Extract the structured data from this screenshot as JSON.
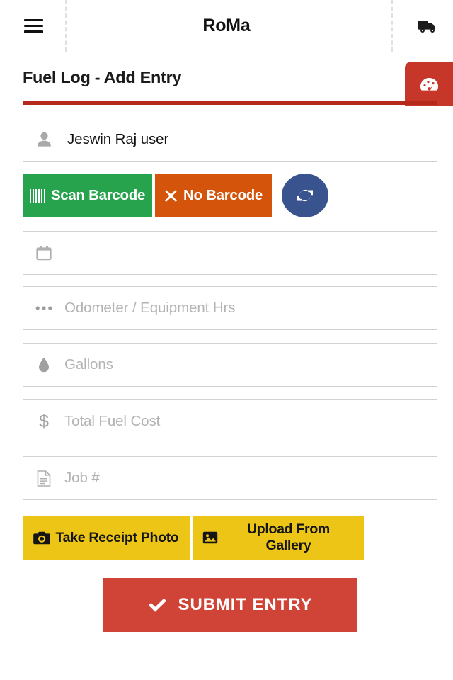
{
  "appbar": {
    "menu_icon": "hamburger-menu-icon",
    "title": "RoMa",
    "truck_icon": "truck-icon"
  },
  "page": {
    "title": "Fuel Log - Add Entry",
    "dashboard_tab_icon": "dashboard-gauge-icon",
    "accent_red": "#b5291c",
    "tab_red": "#c63729"
  },
  "form": {
    "user": {
      "icon": "user-icon",
      "value": "Jeswin Raj user"
    },
    "barcode": {
      "scan_label": "Scan Barcode",
      "scan_icon": "barcode-icon",
      "scan_color": "#27a34e",
      "no_barcode_label": "No Barcode",
      "no_barcode_icon": "close-x-icon",
      "no_barcode_color": "#d4540b",
      "refresh_icon": "refresh-icon",
      "refresh_color": "#39538f"
    },
    "date": {
      "icon": "calendar-icon",
      "value": "",
      "placeholder": ""
    },
    "odometer": {
      "icon": "ellipsis-icon",
      "value": "",
      "placeholder": "Odometer / Equipment Hrs"
    },
    "gallons": {
      "icon": "fuel-droplet-icon",
      "value": "",
      "placeholder": "Gallons"
    },
    "total_cost": {
      "icon": "dollar-sign-icon",
      "value": "",
      "placeholder": "Total Fuel Cost"
    },
    "job": {
      "icon": "document-icon",
      "value": "",
      "placeholder": "Job #"
    },
    "photo": {
      "take_label": "Take Receipt Photo",
      "take_icon": "camera-icon",
      "gallery_label": "Upload From Gallery",
      "gallery_icon": "image-icon",
      "color": "#edc516"
    },
    "submit": {
      "label": "SUBMIT ENTRY",
      "icon": "check-icon",
      "color": "#cf4437"
    }
  }
}
